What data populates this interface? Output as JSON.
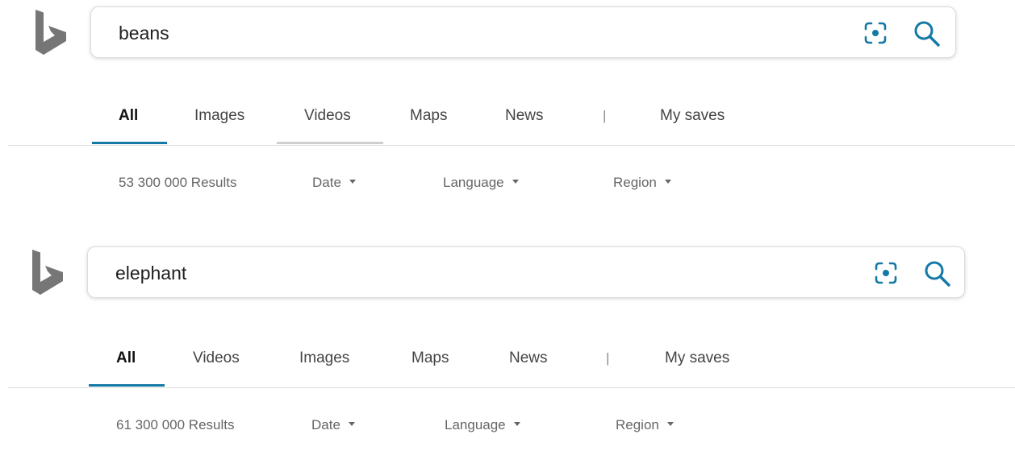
{
  "colors": {
    "accent": "#1479a6",
    "tab_hover_underline": "#cfcfcf",
    "logo_gray": "#767676"
  },
  "panels": [
    {
      "search": {
        "query": "beans",
        "visual_search_icon": "visual-search-icon",
        "search_icon": "magnifier-icon"
      },
      "tabs": [
        {
          "label": "All",
          "active": true
        },
        {
          "label": "Images"
        },
        {
          "label": "Videos",
          "hovered": true
        },
        {
          "label": "Maps"
        },
        {
          "label": "News"
        },
        {
          "label": "My saves"
        }
      ],
      "separator": "|",
      "filters": {
        "results": "53 300 000 Results",
        "date": "Date",
        "language": "Language",
        "region": "Region"
      }
    },
    {
      "search": {
        "query": "elephant",
        "visual_search_icon": "visual-search-icon",
        "search_icon": "magnifier-icon"
      },
      "tabs": [
        {
          "label": "All",
          "active": true
        },
        {
          "label": "Videos"
        },
        {
          "label": "Images"
        },
        {
          "label": "Maps"
        },
        {
          "label": "News"
        },
        {
          "label": "My saves"
        }
      ],
      "separator": "|",
      "filters": {
        "results": "61 300 000 Results",
        "date": "Date",
        "language": "Language",
        "region": "Region"
      }
    }
  ]
}
